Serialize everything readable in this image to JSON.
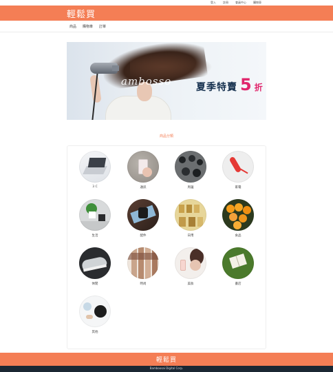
{
  "topbar": {
    "links": [
      "登入",
      "註冊",
      "會員中心",
      "購物車"
    ]
  },
  "brand": {
    "logo_text": "輕鬆買"
  },
  "nav": {
    "items": [
      "商品",
      "購物車",
      "訂單"
    ]
  },
  "banner": {
    "watermark": "ambosso",
    "promo_text": "夏季特賣",
    "promo_number": "5",
    "promo_suffix": "折"
  },
  "categories": {
    "title": "商品分類",
    "items": [
      {
        "label": "3 C",
        "icon": "laptop-photo"
      },
      {
        "label": "通訊",
        "icon": "phone-in-hand-photo"
      },
      {
        "label": "周邊",
        "icon": "camera-gear-photo"
      },
      {
        "label": "家電",
        "icon": "red-telephone-photo"
      },
      {
        "label": "生活",
        "icon": "plant-desk-photo"
      },
      {
        "label": "配件",
        "icon": "wristwatch-photo"
      },
      {
        "label": "日用",
        "icon": "jars-shelf-photo"
      },
      {
        "label": "食品",
        "icon": "oranges-photo"
      },
      {
        "label": "休閒",
        "icon": "sneakers-photo"
      },
      {
        "label": "時尚",
        "icon": "fashion-legs-photo"
      },
      {
        "label": "美妝",
        "icon": "perfume-photo"
      },
      {
        "label": "書店",
        "icon": "book-grass-photo"
      },
      {
        "label": "其他",
        "icon": "misc-objects-photo"
      }
    ]
  },
  "footer": {
    "logo_text": "輕鬆買",
    "copyright": "Bamboosai Digital Corp."
  },
  "colors": {
    "brand_orange": "#f47e55",
    "dark_footer": "#1b2733",
    "promo_pink": "#e0256b",
    "promo_navy": "#16314f"
  }
}
